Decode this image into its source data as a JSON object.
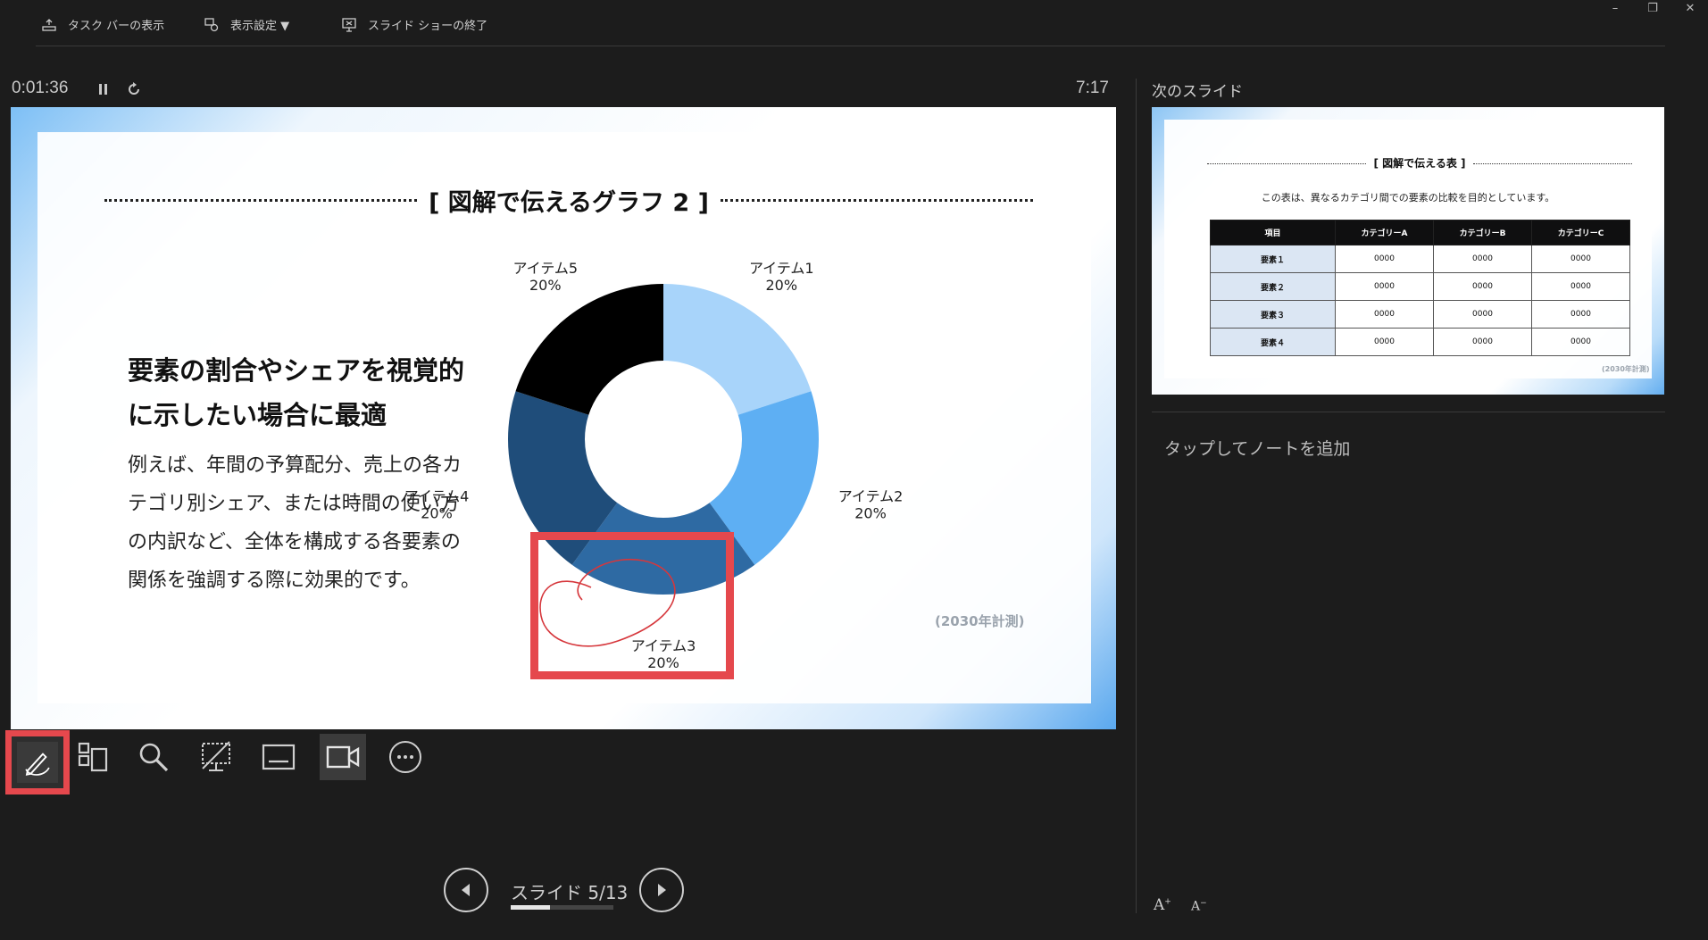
{
  "topbar": {
    "taskbar_label": "タスク バーの表示",
    "display_settings_label": "表示設定 ▼",
    "end_show_label": "スライド ショーの終了",
    "minimize": "–",
    "restore": "❐",
    "close": "✕"
  },
  "presenter": {
    "elapsed_time": "0:01:36",
    "clock": "7:17"
  },
  "slide": {
    "title": "[ 図解で伝えるグラフ 2 ]",
    "headline_line1": "要素の割合やシェアを視覚的",
    "headline_line2": "に示したい場合に最適",
    "body_lines": [
      "例えば、年間の予算配分、売上の各カ",
      "テゴリ別シェア、または時間の使い方",
      "の内訳など、全体を構成する各要素の",
      "関係を強調する際に効果的です。"
    ],
    "footnote": "(2030年計測)"
  },
  "chart_data": {
    "type": "pie",
    "categories": [
      "アイテム1",
      "アイテム2",
      "アイテム3",
      "アイテム4",
      "アイテム5"
    ],
    "values": [
      20,
      20,
      20,
      20,
      20
    ],
    "value_labels": [
      "20%",
      "20%",
      "20%",
      "20%",
      "20%"
    ],
    "colors": [
      "#a8d4fa",
      "#5eaff3",
      "#2e6aa3",
      "#1f4d7a",
      "#000000"
    ],
    "donut": true
  },
  "nav": {
    "slide_counter": "スライド 5/13",
    "progress": 0.385
  },
  "next_slide": {
    "section_label": "次のスライド",
    "title": "[ 図解で伝える表 ]",
    "subtitle": "この表は、異なるカテゴリ間での要素の比較を目的としています。",
    "headers": [
      "項目",
      "カテゴリーA",
      "カテゴリーB",
      "カテゴリーC"
    ],
    "rows": [
      [
        "要素１",
        "0000",
        "0000",
        "0000"
      ],
      [
        "要素２",
        "0000",
        "0000",
        "0000"
      ],
      [
        "要素３",
        "0000",
        "0000",
        "0000"
      ],
      [
        "要素４",
        "0000",
        "0000",
        "0000"
      ]
    ],
    "note": "(2030年計測)"
  },
  "notes": {
    "placeholder": "タップしてノートを追加"
  },
  "font_controls": {
    "increase": "A",
    "decrease": "A"
  }
}
